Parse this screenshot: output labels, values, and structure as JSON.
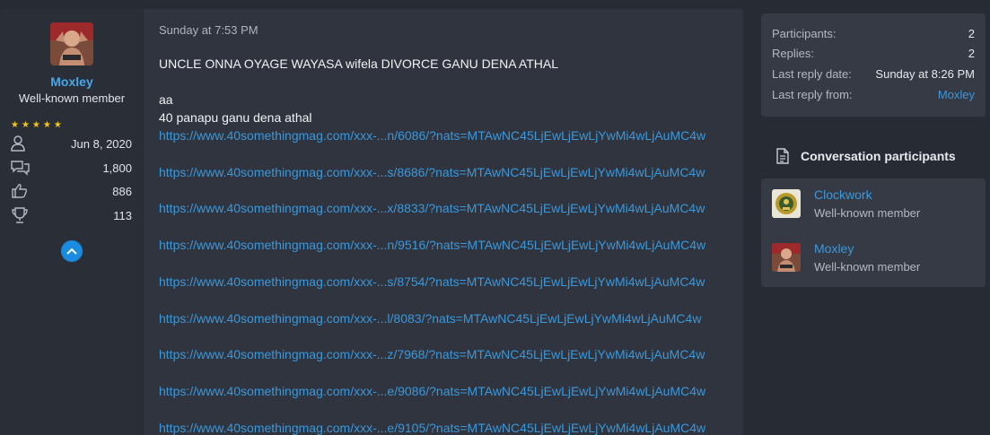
{
  "post": {
    "author": {
      "name": "Moxley",
      "title": "Well-known member",
      "stars": "★★★★★",
      "stats": [
        {
          "icon": "user-icon",
          "value": "Jun 8, 2020"
        },
        {
          "icon": "messages-icon",
          "value": "1,800"
        },
        {
          "icon": "thumbs-up-icon",
          "value": "886"
        },
        {
          "icon": "trophy-icon",
          "value": "113"
        }
      ]
    },
    "date": "Sunday at 7:53 PM",
    "lines": [
      "UNCLE ONNA OYAGE WAYASA wifela DIVORCE GANU DENA ATHAL",
      "",
      "aa",
      "40 panapu ganu dena athal"
    ],
    "links": [
      "https://www.40somethingmag.com/xxx-...n/6086/?nats=MTAwNC45LjEwLjEwLjYwMi4wLjAuMC4w",
      "https://www.40somethingmag.com/xxx-...s/8686/?nats=MTAwNC45LjEwLjEwLjYwMi4wLjAuMC4w",
      "https://www.40somethingmag.com/xxx-...x/8833/?nats=MTAwNC45LjEwLjEwLjYwMi4wLjAuMC4w",
      "https://www.40somethingmag.com/xxx-...n/9516/?nats=MTAwNC45LjEwLjEwLjYwMi4wLjAuMC4w",
      "https://www.40somethingmag.com/xxx-...s/8754/?nats=MTAwNC45LjEwLjEwLjYwMi4wLjAuMC4w",
      "https://www.40somethingmag.com/xxx-...l/8083/?nats=MTAwNC45LjEwLjEwLjYwMi4wLjAuMC4w",
      "https://www.40somethingmag.com/xxx-...z/7968/?nats=MTAwNC45LjEwLjEwLjYwMi4wLjAuMC4w",
      "https://www.40somethingmag.com/xxx-...e/9086/?nats=MTAwNC45LjEwLjEwLjYwMi4wLjAuMC4w",
      "https://www.40somethingmag.com/xxx-...e/9105/?nats=MTAwNC45LjEwLjEwLjYwMi4wLjAuMC4w"
    ]
  },
  "sidebar": {
    "meta": [
      {
        "key": "Participants:",
        "value": "2"
      },
      {
        "key": "Replies:",
        "value": "2"
      },
      {
        "key": "Last reply date:",
        "value": "Sunday at 8:26 PM"
      },
      {
        "key": "Last reply from:",
        "value": "Moxley"
      }
    ],
    "participants_title": "Conversation participants",
    "participants": [
      {
        "name": "Clockwork",
        "title": "Well-known member"
      },
      {
        "name": "Moxley",
        "title": "Well-known member"
      }
    ]
  },
  "colors": {
    "accent": "#3a98db",
    "background": "#272b34",
    "panel": "#30343e",
    "star": "#f5c518"
  }
}
